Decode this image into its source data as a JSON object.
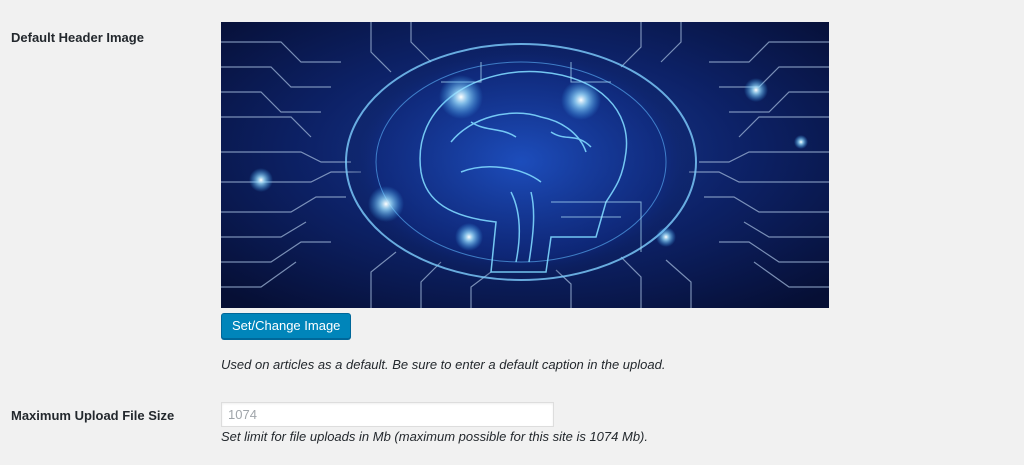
{
  "header_image_row": {
    "label": "Default Header Image",
    "image_icon": "brain-circuit-image",
    "button_label": "Set/Change Image",
    "help_text": "Used on articles as a default. Be sure to enter a default caption in the upload."
  },
  "upload_size_row": {
    "label": "Maximum Upload File Size",
    "placeholder": "1074",
    "value": "",
    "help_text": "Set limit for file uploads in Mb (maximum possible for this site is 1074 Mb)."
  },
  "colors": {
    "background": "#f1f1f1",
    "button": "#0085ba",
    "button_border": "#006799",
    "image_dark": "#0a1a4a",
    "image_glow": "#3ab0ff"
  }
}
